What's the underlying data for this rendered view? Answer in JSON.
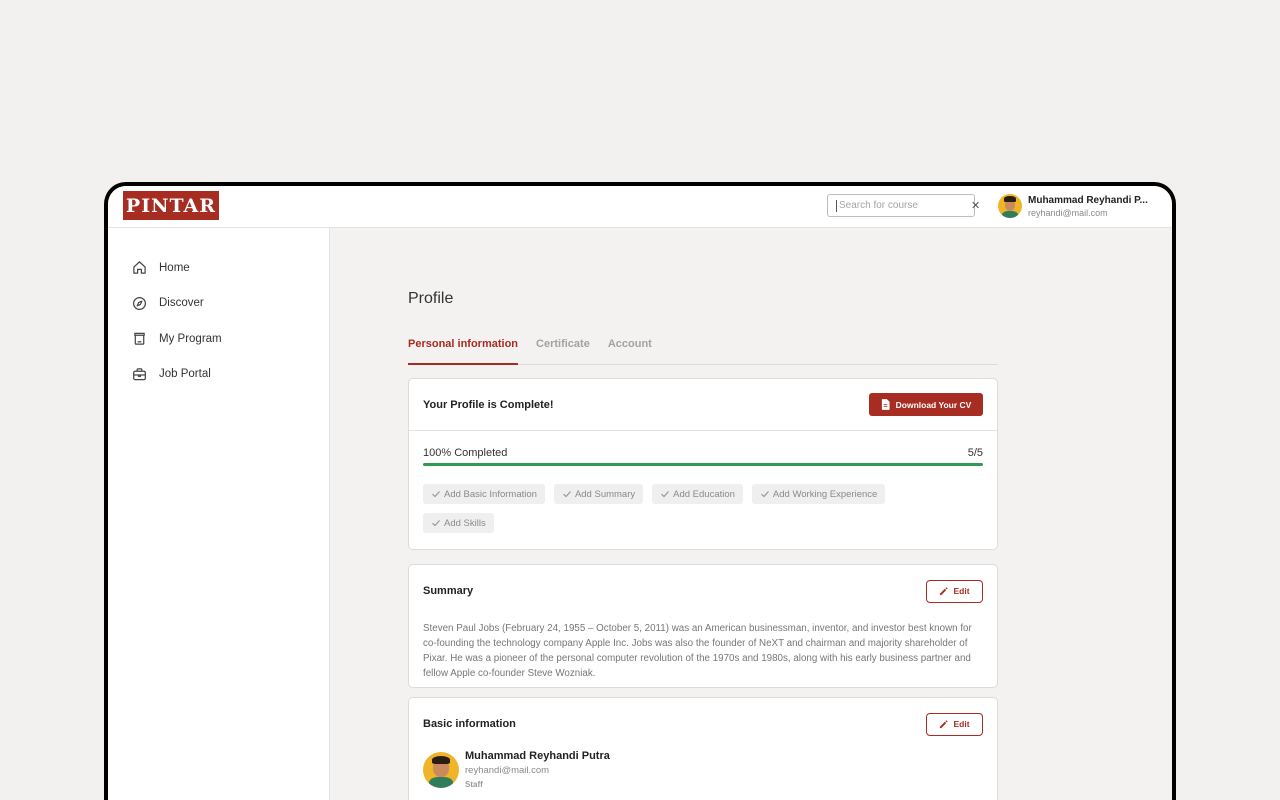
{
  "brand": {
    "logo_text": "PINTAR",
    "accent": "#a72c22",
    "success": "#2e9b4e"
  },
  "header": {
    "search_placeholder": "Search for course",
    "clear_icon": "close-icon",
    "user_name": "Muhammad Reyhandi P...",
    "user_email": "reyhandi@mail.com"
  },
  "sidebar": {
    "items": [
      {
        "label": "Home",
        "icon": "home-icon"
      },
      {
        "label": "Discover",
        "icon": "compass-icon"
      },
      {
        "label": "My Program",
        "icon": "bag-icon"
      },
      {
        "label": "Job Portal",
        "icon": "briefcase-icon"
      }
    ]
  },
  "main": {
    "title": "Profile",
    "tabs": [
      {
        "label": "Personal information",
        "active": true
      },
      {
        "label": "Certificate",
        "active": false
      },
      {
        "label": "Account",
        "active": false
      }
    ],
    "completion": {
      "title": "Your Profile is Complete!",
      "download_label": "Download Your CV",
      "progress_label": "100% Completed",
      "progress_count": "5/5",
      "progress_fraction": 1.0,
      "steps": [
        "Add Basic Information",
        "Add Summary",
        "Add Education",
        "Add Working Experience",
        "Add Skills"
      ]
    },
    "summary": {
      "title": "Summary",
      "edit_label": "Edit",
      "text": "Steven Paul Jobs (February 24, 1955 – October 5, 2011) was an American businessman, inventor, and investor best known for co-founding the technology company Apple Inc. Jobs was also the founder of NeXT and chairman and majority shareholder of Pixar. He was a pioneer of the personal computer revolution of the 1970s and 1980s, along with his early business partner and fellow Apple co-founder Steve Wozniak."
    },
    "basic": {
      "title": "Basic information",
      "edit_label": "Edit",
      "name": "Muhammad Reyhandi Putra",
      "email": "reyhandi@mail.com",
      "role": "Staff"
    }
  }
}
